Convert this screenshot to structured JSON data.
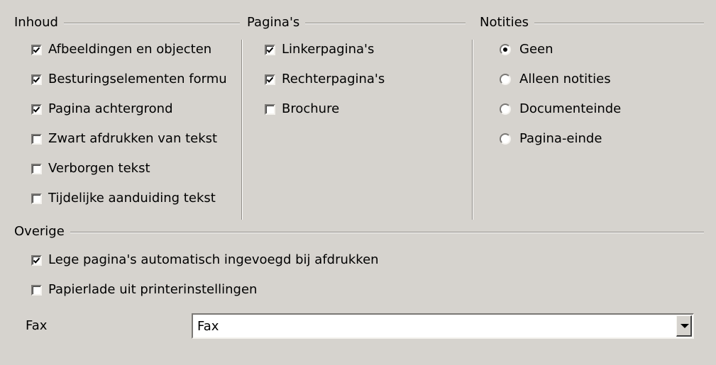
{
  "inhoud": {
    "title": "Inhoud",
    "items": [
      {
        "label": "Afbeeldingen en objecten",
        "checked": true
      },
      {
        "label": "Besturingselementen formulier",
        "checked": true
      },
      {
        "label": "Pagina achtergrond",
        "checked": true
      },
      {
        "label": "Zwart afdrukken van tekst",
        "checked": false
      },
      {
        "label": "Verborgen tekst",
        "checked": false
      },
      {
        "label": "Tijdelijke aanduiding tekst",
        "checked": false
      }
    ]
  },
  "paginas": {
    "title": "Pagina's",
    "items": [
      {
        "label": "Linkerpagina's",
        "checked": true
      },
      {
        "label": "Rechterpagina's",
        "checked": true
      },
      {
        "label": "Brochure",
        "checked": false
      }
    ]
  },
  "notities": {
    "title": "Notities",
    "items": [
      {
        "label": "Geen",
        "selected": true
      },
      {
        "label": "Alleen notities",
        "selected": false
      },
      {
        "label": "Documenteinde",
        "selected": false
      },
      {
        "label": "Pagina-einde",
        "selected": false
      }
    ]
  },
  "overige": {
    "title": "Overige",
    "items": [
      {
        "label": "Lege pagina's automatisch ingevoegd bij afdrukken",
        "checked": true
      },
      {
        "label": "Papierlade uit printerinstellingen",
        "checked": false
      }
    ],
    "fax_label": "Fax",
    "fax_value": "Fax"
  }
}
